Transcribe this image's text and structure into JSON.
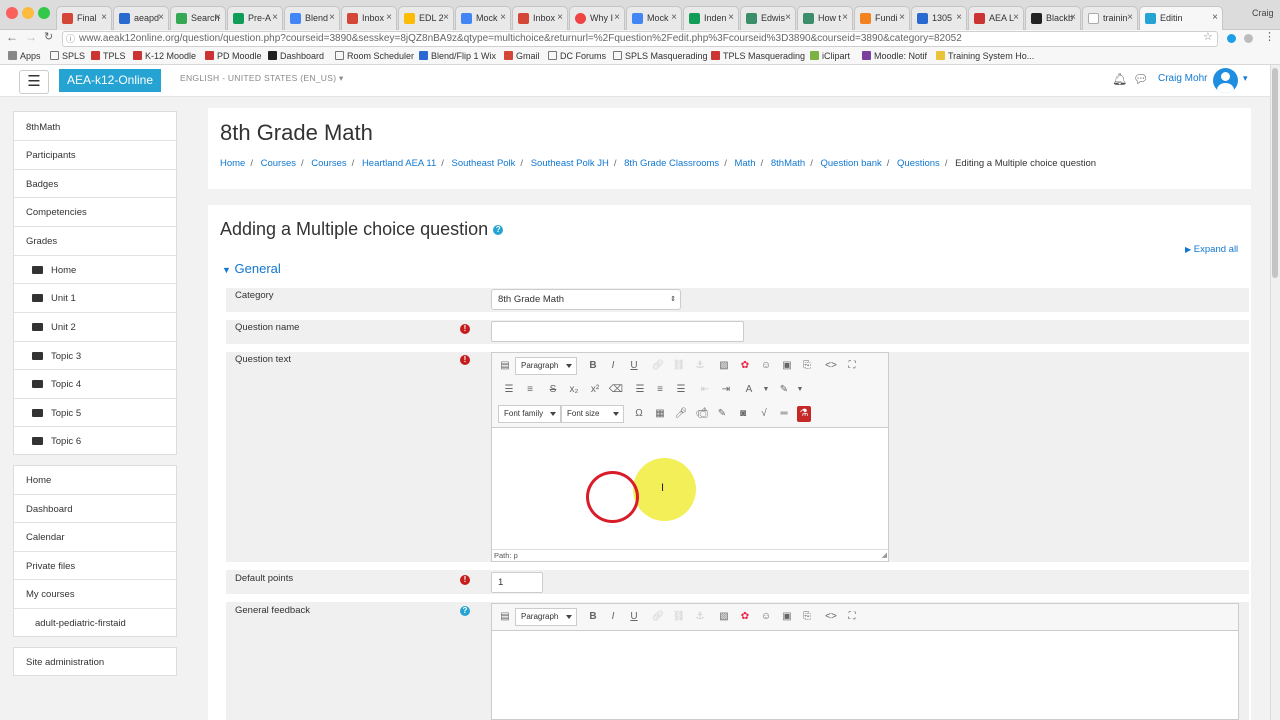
{
  "browser": {
    "tabs": [
      "Final",
      "aeapd",
      "Search",
      "Pre-A",
      "Blend",
      "Inbox",
      "EDL 2",
      "Mock",
      "Inbox",
      "Why I",
      "Mock",
      "Inden",
      "Edwis",
      "How t",
      "Fundi",
      "1305",
      "AEA L",
      "Blackb",
      "trainin",
      "Editin"
    ],
    "profile_name": "Craig",
    "url": "www.aeak12online.org/question/question.php?courseid=3890&sesskey=8jQZ8nBA9z&qtype=multichoice&returnurl=%2Fquestion%2Fedit.php%3Fcourseid%3D3890&courseid=3890&category=82052",
    "bookmarks": [
      "Apps",
      "SPLS",
      "TPLS",
      "K-12 Moodle",
      "PD Moodle",
      "Dashboard",
      "Room Scheduler",
      "Blend/Flip 1 Wix",
      "Gmail",
      "DC Forums",
      "SPLS Masquerading",
      "TPLS Masquerading",
      "iClipart",
      "Moodle: Notif",
      "Training System Ho..."
    ]
  },
  "header": {
    "brand": "AEA-k12-Online",
    "language": "ENGLISH - UNITED STATES (EN_US)",
    "user_name": "Craig Mohr",
    "menu_icon": "hamburger-icon",
    "notification_icon": "bell-icon",
    "message_icon": "chat-icon"
  },
  "sidebar": {
    "course_items": [
      "8thMath",
      "Participants",
      "Badges",
      "Competencies",
      "Grades"
    ],
    "sections": [
      "Home",
      "Unit 1",
      "Unit 2",
      "Topic 3",
      "Topic 4",
      "Topic 5",
      "Topic 6"
    ],
    "site_items": [
      "Home",
      "Dashboard",
      "Calendar",
      "Private files",
      "My courses"
    ],
    "my_course": "adult-pediatric-firstaid",
    "admin": "Site administration"
  },
  "page": {
    "title": "8th Grade Math",
    "breadcrumbs": [
      "Home",
      "Courses",
      "Courses",
      "Heartland AEA 11",
      "Southeast Polk",
      "Southeast Polk JH",
      "8th Grade Classrooms",
      "Math",
      "8thMath",
      "Question bank",
      "Questions"
    ],
    "breadcrumb_current": "Editing a Multiple choice question"
  },
  "form": {
    "heading": "Adding a Multiple choice question",
    "expand_all": "Expand all",
    "section": "General",
    "category_label": "Category",
    "category_value": "8th Grade Math",
    "question_name_label": "Question name",
    "question_name_value": "",
    "question_text_label": "Question text",
    "format_select": "Paragraph",
    "font_family_select": "Font family",
    "font_size_select": "Font size",
    "editor_path": "Path: p",
    "default_points_label": "Default points",
    "default_points_value": "1",
    "general_feedback_label": "General feedback",
    "colors": {
      "brand": "#25a3d3",
      "link": "#1177d1",
      "required": "#c61c1c"
    }
  }
}
